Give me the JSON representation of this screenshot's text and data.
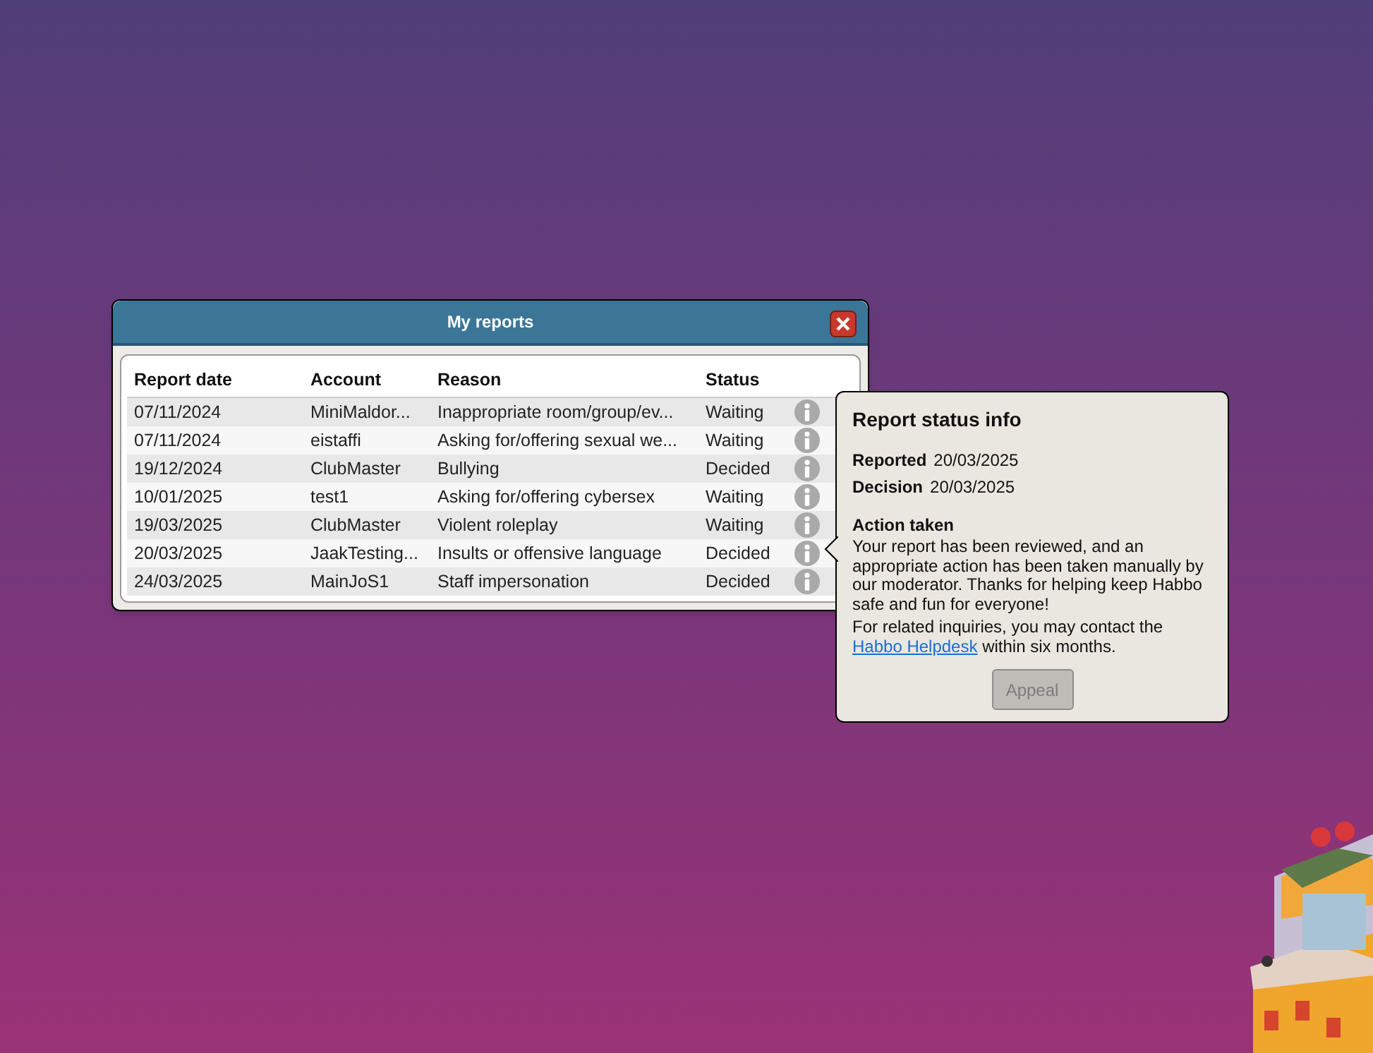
{
  "window": {
    "title": "My reports"
  },
  "table": {
    "columns": [
      "Report date",
      "Account",
      "Reason",
      "Status"
    ],
    "rows": [
      {
        "cells": [
          "07/11/2024",
          "MiniMaldor...",
          "Inappropriate room/group/ev...",
          "Waiting"
        ]
      },
      {
        "cells": [
          "07/11/2024",
          "eistaffi",
          "Asking for/offering sexual we...",
          "Waiting"
        ]
      },
      {
        "cells": [
          "19/12/2024",
          "ClubMaster",
          "Bullying",
          "Decided"
        ]
      },
      {
        "cells": [
          "10/01/2025",
          "test1",
          "Asking for/offering cybersex",
          "Waiting"
        ]
      },
      {
        "cells": [
          "19/03/2025",
          "ClubMaster",
          "Violent roleplay",
          "Waiting"
        ]
      },
      {
        "cells": [
          "20/03/2025",
          "JaakTesting...",
          "Insults or offensive language",
          "Decided"
        ]
      },
      {
        "cells": [
          "24/03/2025",
          "MainJoS1",
          "Staff impersonation",
          "Decided"
        ]
      }
    ]
  },
  "popup": {
    "title": "Report status info",
    "fields": [
      {
        "label": "Reported",
        "value": "20/03/2025"
      },
      {
        "label": "Decision",
        "value": "20/03/2025"
      }
    ],
    "section_title": "Action taken",
    "body": "Your report has been reviewed, and an appropriate action has been taken manually by our moderator. Thanks for helping keep Habbo safe and fun for everyone!",
    "contact_before": "For related inquiries, you may contact the",
    "link": "Habbo Helpdesk",
    "contact_after": "within six months.",
    "button": {
      "label": "Appeal",
      "disabled": true
    }
  }
}
